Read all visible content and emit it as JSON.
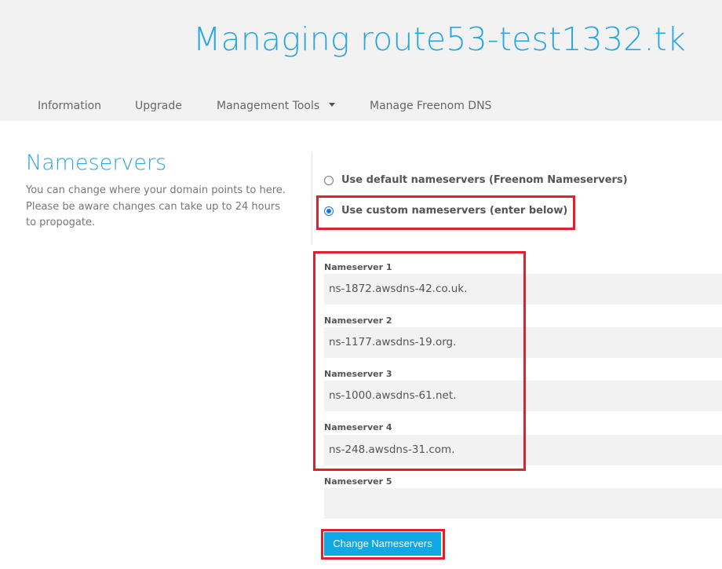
{
  "header": {
    "title": "Managing route53-test1332.tk"
  },
  "nav": {
    "items": [
      {
        "label": "Information"
      },
      {
        "label": "Upgrade"
      },
      {
        "label": "Management Tools"
      },
      {
        "label": "Manage Freenom DNS"
      }
    ]
  },
  "section": {
    "title": "Nameservers",
    "description": "You can change where your domain points to here. Please be aware changes can take up to 24 hours to propogate."
  },
  "options": [
    {
      "label": "Use default nameservers (Freenom Nameservers)",
      "selected": false
    },
    {
      "label": "Use custom nameservers (enter below)",
      "selected": true
    }
  ],
  "nameservers": [
    {
      "label": "Nameserver 1",
      "value": "ns-1872.awsdns-42.co.uk."
    },
    {
      "label": "Nameserver 2",
      "value": "ns-1177.awsdns-19.org."
    },
    {
      "label": "Nameserver 3",
      "value": "ns-1000.awsdns-61.net."
    },
    {
      "label": "Nameserver 4",
      "value": "ns-248.awsdns-31.com."
    },
    {
      "label": "Nameserver 5",
      "value": ""
    }
  ],
  "submit": {
    "label": "Change Nameservers"
  },
  "colors": {
    "accent": "#2aa6e0",
    "button": "#10a7e5",
    "highlight": "#e0202a",
    "header_bg": "#f2f2f2"
  }
}
